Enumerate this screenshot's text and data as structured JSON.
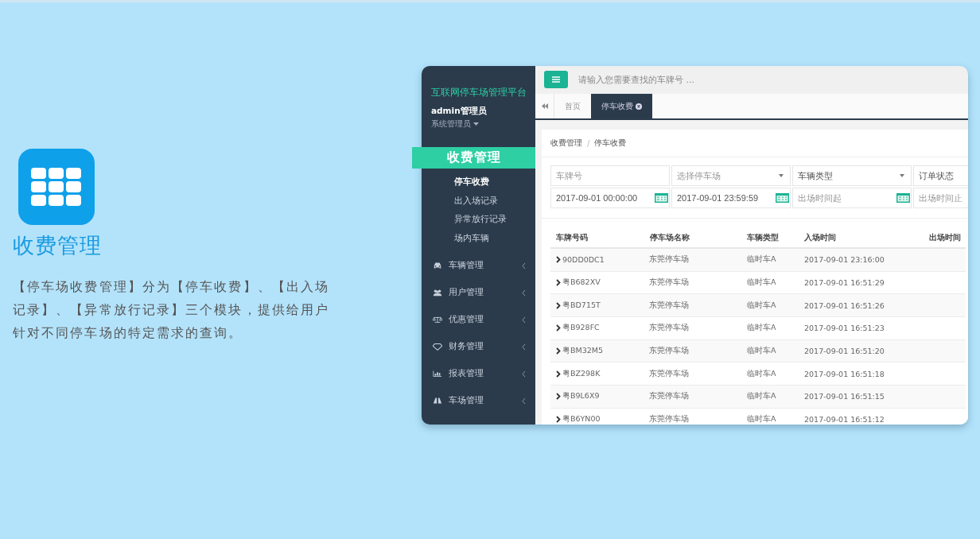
{
  "intro": {
    "title": "收费管理",
    "description": "【停车场收费管理】分为【停车收费】、【出入场记录】、【异常放行记录】三个模块，提供给用户针对不同停车场的特定需求的查询。"
  },
  "app": {
    "sidebar": {
      "brand": "互联网停车场管理平台",
      "user_name": "admin管理员",
      "user_role": "系统管理员",
      "section": {
        "label": "收费管理",
        "children": [
          {
            "label": "停车收费",
            "selected": true
          },
          {
            "label": "出入场记录",
            "selected": false
          },
          {
            "label": "异常放行记录",
            "selected": false
          },
          {
            "label": "场内车辆",
            "selected": false
          }
        ]
      },
      "menu": [
        {
          "label": "车辆管理",
          "expanded": false
        },
        {
          "label": "用户管理",
          "expanded": false
        },
        {
          "label": "优惠管理",
          "expanded": false
        },
        {
          "label": "财务管理",
          "expanded": false
        },
        {
          "label": "报表管理",
          "expanded": false
        },
        {
          "label": "车场管理",
          "expanded": false
        }
      ]
    },
    "search": {
      "placeholder": "请输入您需要查找的车牌号 ..."
    },
    "tabs": [
      {
        "label": "首页",
        "selected": false,
        "closable": false
      },
      {
        "label": "停车收费",
        "selected": true,
        "closable": true
      }
    ],
    "breadcrumb": {
      "items": [
        "收费管理",
        "停车收费"
      ],
      "separator": "/"
    },
    "filters": [
      {
        "kind": "text",
        "placeholder": "车牌号"
      },
      {
        "kind": "select",
        "placeholder": "选择停车场"
      },
      {
        "kind": "select",
        "value": "车辆类型"
      },
      {
        "kind": "text",
        "value": "订单状态"
      },
      {
        "kind": "date",
        "value": "2017-09-01 00:00:00"
      },
      {
        "kind": "date",
        "value": "2017-09-01 23:59:59"
      },
      {
        "kind": "date",
        "placeholder": "出场时间起"
      },
      {
        "kind": "text",
        "placeholder": "出场时间止"
      }
    ],
    "table": {
      "columns": [
        "车牌号码",
        "停车场名称",
        "车辆类型",
        "入场时间",
        "出场时间"
      ],
      "rows": [
        [
          "90DD0DC1",
          "东莞停车场",
          "临时车A",
          "2017-09-01 23:16:00"
        ],
        [
          "粤B682XV",
          "东莞停车场",
          "临时车A",
          "2017-09-01 16:51:29"
        ],
        [
          "粤BD715T",
          "东莞停车场",
          "临时车A",
          "2017-09-01 16:51:26"
        ],
        [
          "粤B928FC",
          "东莞停车场",
          "临时车A",
          "2017-09-01 16:51:23"
        ],
        [
          "粤BM32M5",
          "东莞停车场",
          "临时车A",
          "2017-09-01 16:51:20"
        ],
        [
          "粤BZ298K",
          "东莞停车场",
          "临时车A",
          "2017-09-01 16:51:18"
        ],
        [
          "粤B9L6X9",
          "东莞停车场",
          "临时车A",
          "2017-09-01 16:51:15"
        ],
        [
          "粤B6YN00",
          "东莞停车场",
          "临时车A",
          "2017-09-01 16:51:12"
        ]
      ]
    }
  }
}
